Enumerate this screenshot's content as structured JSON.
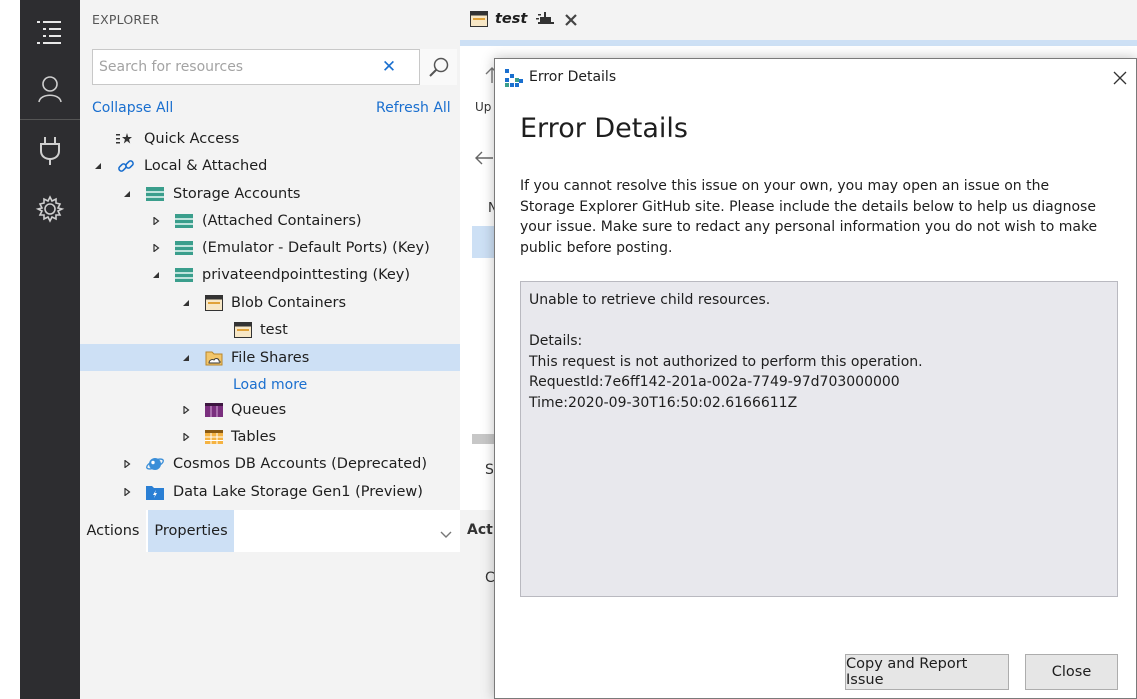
{
  "activity_bar": {
    "items": [
      {
        "icon": "explorer-list-icon"
      },
      {
        "icon": "account-icon"
      },
      {
        "icon": "plug-icon"
      },
      {
        "icon": "settings-gear-icon"
      }
    ]
  },
  "explorer": {
    "title": "EXPLORER",
    "search": {
      "placeholder": "Search for resources",
      "value": ""
    },
    "collapse_all": "Collapse All",
    "refresh_all": "Refresh All",
    "tree": [
      {
        "label": "Quick Access",
        "icon": "quick-access-icon"
      },
      {
        "label": "Local & Attached",
        "icon": "link-icon",
        "expanded": true
      },
      {
        "label": "Storage Accounts",
        "icon": "storage-account-icon",
        "expanded": true
      },
      {
        "label": "(Attached Containers)",
        "icon": "storage-account-icon",
        "expanded": false
      },
      {
        "label": "(Emulator - Default Ports) (Key)",
        "icon": "storage-account-icon",
        "expanded": false
      },
      {
        "label": "privateendpointtesting (Key)",
        "icon": "storage-account-icon",
        "expanded": true
      },
      {
        "label": "Blob Containers",
        "icon": "blob-container-icon",
        "expanded": true
      },
      {
        "label": "test",
        "icon": "blob-container-icon"
      },
      {
        "label": "File Shares",
        "icon": "file-share-icon",
        "expanded": true,
        "selected": true
      },
      {
        "label": "Load more"
      },
      {
        "label": "Queues",
        "icon": "queue-icon",
        "expanded": false
      },
      {
        "label": "Tables",
        "icon": "table-icon",
        "expanded": false
      },
      {
        "label": "Cosmos DB Accounts (Deprecated)",
        "icon": "cosmos-db-icon",
        "expanded": false
      },
      {
        "label": "Data Lake Storage Gen1 (Preview)",
        "icon": "data-lake-icon",
        "expanded": false
      }
    ],
    "bottom_tabs": {
      "actions": "Actions",
      "properties": "Properties",
      "selected": "Properties"
    }
  },
  "editor": {
    "tab": {
      "label": "test"
    },
    "partial_text": {
      "upload": "Up",
      "col": "N",
      "s": "S",
      "actions": "Acti",
      "c": "C"
    }
  },
  "dialog": {
    "window_title": "Error Details",
    "heading": "Error Details",
    "description": "If you cannot resolve this issue on your own, you may open an issue on the Storage Explorer GitHub site. Please include the details below to help us diagnose your issue. Make sure to redact any personal information you do not wish to make public before posting.",
    "details": {
      "line1": "Unable to retrieve child resources.",
      "line2": "Details:",
      "line3": "This request is not authorized to perform this operation.",
      "line4": "RequestId:7e6ff142-201a-002a-7749-97d703000000",
      "line5": "Time:2020-09-30T16:50:02.6166611Z"
    },
    "buttons": {
      "report": "Copy and Report Issue",
      "close": "Close"
    }
  },
  "colors": {
    "activity_bg": "#2d2d30",
    "panel_bg": "#f3f3f3",
    "selection": "#cde0f5",
    "link": "#1a6fcf",
    "details_bg": "#e8e8ed"
  }
}
